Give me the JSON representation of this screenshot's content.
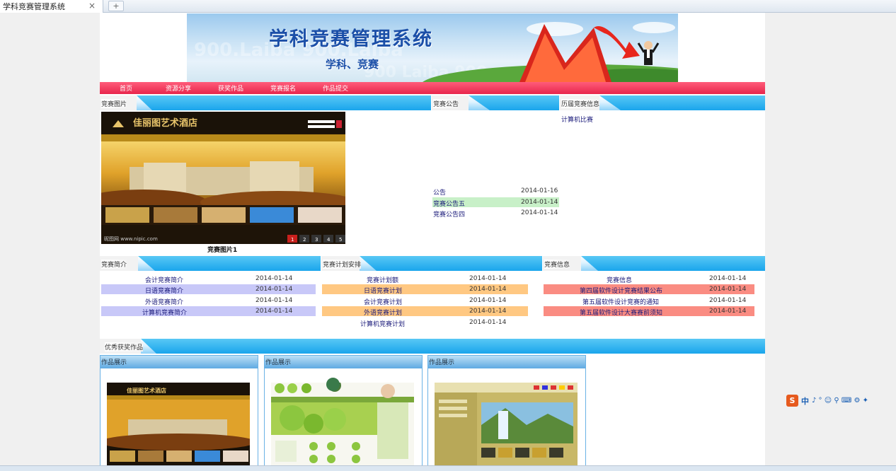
{
  "browser": {
    "tab_title": "学科竞赛管理系统",
    "close_glyph": "×",
    "new_tab_glyph": "+"
  },
  "banner": {
    "title": "学科竞赛管理系统",
    "subtitle": "学科、竞赛"
  },
  "nav": [
    "首页",
    "资源分享",
    "获奖作品",
    "竞赛报名",
    "作品提交"
  ],
  "sections": {
    "photos": {
      "header": "竞赛图片",
      "caption": "竞赛图片1",
      "site_brand": "佳丽图艺术酒店",
      "footer_brand": "昵图网 www.nipic.com",
      "pager": [
        "1",
        "2",
        "3",
        "4",
        "5"
      ]
    },
    "notices": {
      "header": "竞赛公告",
      "items": [
        {
          "title": "公告",
          "date": "2014-01-16",
          "highlight": ""
        },
        {
          "title": "竞赛公告五",
          "date": "2014-01-14",
          "highlight": "#c8f0c8"
        },
        {
          "title": "竞赛公告四",
          "date": "2014-01-14",
          "highlight": ""
        }
      ]
    },
    "history": {
      "header": "历届竞赛信息",
      "items": [
        "计算机比赛"
      ]
    },
    "intro": {
      "header": "竞赛简介",
      "items": [
        {
          "title": "会计竞赛简介",
          "date": "2014-01-14",
          "highlight": ""
        },
        {
          "title": "日语竞赛简介",
          "date": "2014-01-14",
          "highlight": "#c8c8f8"
        },
        {
          "title": "外语竞赛简介",
          "date": "2014-01-14",
          "highlight": ""
        },
        {
          "title": "计算机竞赛简介",
          "date": "2014-01-14",
          "highlight": "#c8c8f8"
        }
      ]
    },
    "plans": {
      "header": "竞赛计划安排",
      "items": [
        {
          "title": "竞赛计划额",
          "date": "2014-01-14",
          "highlight": ""
        },
        {
          "title": "日语竞赛计划",
          "date": "2014-01-14",
          "highlight": "#ffc882"
        },
        {
          "title": "会计竞赛计划",
          "date": "2014-01-14",
          "highlight": ""
        },
        {
          "title": "外语竞赛计划",
          "date": "2014-01-14",
          "highlight": "#ffc882"
        },
        {
          "title": "计算机竞赛计划",
          "date": "2014-01-14",
          "highlight": ""
        }
      ]
    },
    "info": {
      "header": "竞赛信息",
      "items": [
        {
          "title": "竞赛信息",
          "date": "2014-01-14",
          "highlight": ""
        },
        {
          "title": "第四届软件设计竞赛结果公布",
          "date": "2014-01-14",
          "highlight": "#fa8c82"
        },
        {
          "title": "第五届软件设计竞赛的通知",
          "date": "2014-01-14",
          "highlight": ""
        },
        {
          "title": "第五届软件设计大赛赛前须知",
          "date": "2014-01-14",
          "highlight": "#fa8c82"
        }
      ]
    },
    "works": {
      "header": "优秀获奖作品",
      "items": [
        {
          "label": "作品展示",
          "theme": "hotel"
        },
        {
          "label": "作品展示",
          "theme": "apple"
        },
        {
          "label": "作品展示",
          "theme": "landscape"
        }
      ]
    }
  },
  "ime": {
    "logo": "S",
    "mode": "中",
    "icons": "♪ ° ☺ ⚲ ⌨ ⚙ ✦"
  }
}
